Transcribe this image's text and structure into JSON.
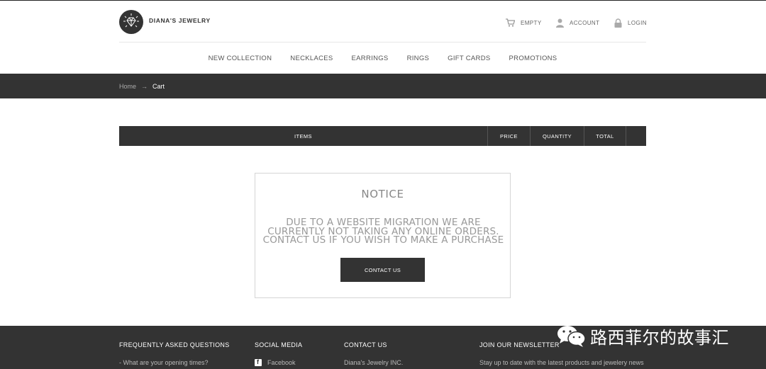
{
  "brand": {
    "name": "DIANA'S JEWELRY"
  },
  "header": {
    "cart_label": "EMPTY",
    "account_label": "ACCOUNT",
    "login_label": "LOGIN"
  },
  "nav": {
    "items": [
      "NEW COLLECTION",
      "NECKLACES",
      "EARRINGS",
      "RINGS",
      "GIFT CARDS",
      "PROMOTIONS"
    ]
  },
  "breadcrumb": {
    "home": "Home",
    "separator": "→",
    "current": "Cart"
  },
  "cart_table": {
    "columns": [
      "ITEMS",
      "PRICE",
      "QUANTITY",
      "TOTAL"
    ]
  },
  "notice": {
    "title": "NOTICE",
    "message": "Due to a website migration we are currently not taking any online orders. Contact us if you wish to make a purchase",
    "button_label": "CONTACT US"
  },
  "footer": {
    "faq": {
      "heading": "FREQUENTLY ASKED QUESTIONS",
      "item": "- What are your opening times?"
    },
    "social": {
      "heading": "SOCIAL MEDIA",
      "item": "Facebook"
    },
    "contact": {
      "heading": "CONTACT US",
      "item": "Diana's Jewelry INC."
    },
    "newsletter": {
      "heading": "JOIN OUR NEWSLETTER",
      "item": "Stay up to date with the latest products and jewelery news"
    }
  },
  "watermark": {
    "text": "路西菲尔的故事汇",
    "icon": "wechat-icon"
  },
  "colors": {
    "dark": "#333333",
    "text": "#555555",
    "muted": "#999999"
  }
}
